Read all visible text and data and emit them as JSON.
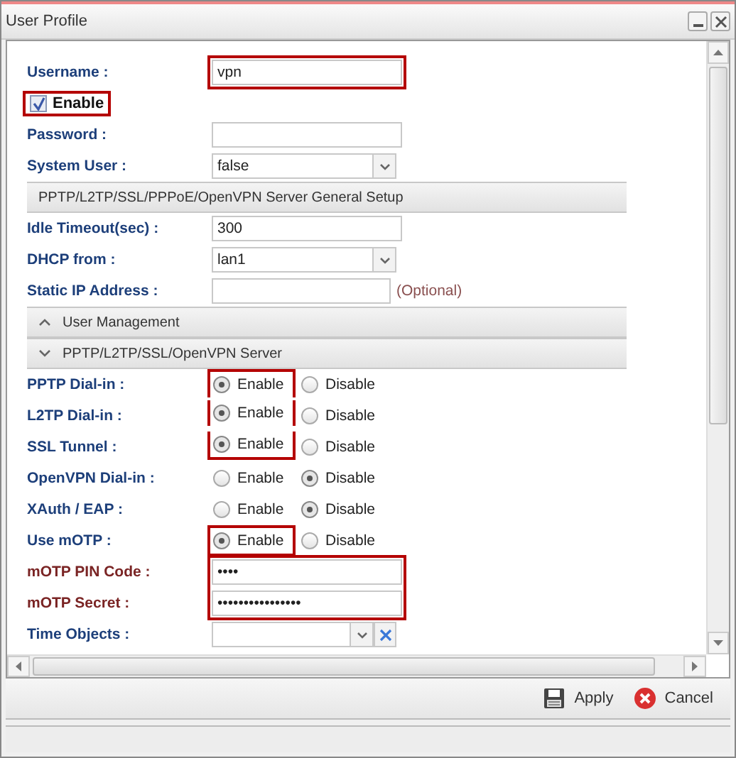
{
  "window": {
    "title": "User Profile"
  },
  "rows": [
    {
      "kind": "text",
      "label": "Username :",
      "value": "vpn",
      "highlighted": true
    },
    {
      "kind": "checkbox",
      "label": "Enable",
      "checked": true,
      "highlighted": true
    },
    {
      "kind": "text",
      "label": "Password :"
    },
    {
      "kind": "select",
      "label": "System User :",
      "value": "false"
    },
    {
      "kind": "section",
      "label": "PPTP/L2TP/SSL/PPPoE/OpenVPN Server General Setup"
    },
    {
      "kind": "text",
      "label": "Idle Timeout(sec) :",
      "value": "300"
    },
    {
      "kind": "select",
      "label": "DHCP from :",
      "value": "lan1"
    },
    {
      "kind": "text",
      "label": "Static IP Address :",
      "hint": "(Optional)"
    },
    {
      "kind": "section",
      "label": "User Management",
      "expanded": false
    },
    {
      "kind": "section",
      "label": "PPTP/L2TP/SSL/OpenVPN Server",
      "expanded": true
    },
    {
      "kind": "radio",
      "label": "PPTP Dial-in :",
      "options": [
        {
          "label": "Enable",
          "selected": true,
          "highlighted": true
        },
        {
          "label": "Disable",
          "selected": false,
          "highlighted": false
        }
      ]
    },
    {
      "kind": "radio",
      "label": "L2TP Dial-in :",
      "options": [
        {
          "label": "Enable",
          "selected": true,
          "highlighted": true
        },
        {
          "label": "Disable",
          "selected": false,
          "highlighted": false
        }
      ]
    },
    {
      "kind": "radio",
      "label": "SSL Tunnel :",
      "options": [
        {
          "label": "Enable",
          "selected": true,
          "highlighted": true
        },
        {
          "label": "Disable",
          "selected": false,
          "highlighted": false
        }
      ]
    },
    {
      "kind": "radio",
      "label": "OpenVPN Dial-in :",
      "options": [
        {
          "label": "Enable",
          "selected": false,
          "highlighted": false
        },
        {
          "label": "Disable",
          "selected": true,
          "highlighted": false
        }
      ]
    },
    {
      "kind": "radio",
      "label": "XAuth / EAP :",
      "options": [
        {
          "label": "Enable",
          "selected": false,
          "highlighted": false
        },
        {
          "label": "Disable",
          "selected": true,
          "highlighted": false
        }
      ]
    },
    {
      "kind": "radio",
      "label": "Use mOTP :",
      "options": [
        {
          "label": "Enable",
          "selected": true,
          "highlighted": true
        },
        {
          "label": "Disable",
          "selected": false,
          "highlighted": false
        }
      ]
    },
    {
      "kind": "text",
      "label": "mOTP PIN Code :",
      "value": "••••",
      "highlighted": true,
      "warn": true
    },
    {
      "kind": "text",
      "label": "mOTP Secret :",
      "value": "••••••••••••••••",
      "highlighted": true,
      "warn": true
    },
    {
      "kind": "select-clear",
      "label": "Time Objects :"
    }
  ],
  "buttons": [
    {
      "kind": "apply",
      "label": "Apply"
    },
    {
      "kind": "cancel",
      "label": "Cancel"
    }
  ]
}
